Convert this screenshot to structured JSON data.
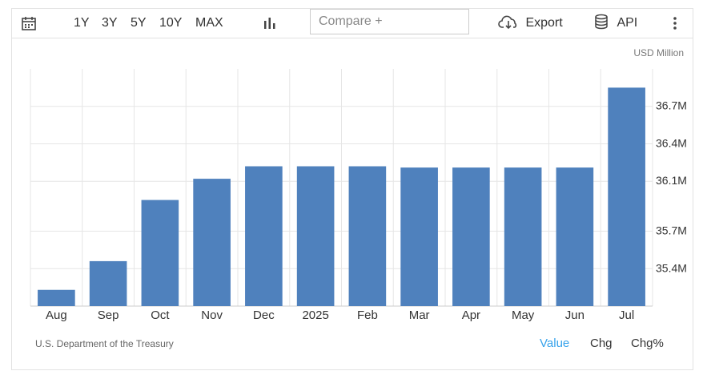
{
  "toolbar": {
    "ranges": [
      "1Y",
      "3Y",
      "5Y",
      "10Y",
      "MAX"
    ],
    "compare_placeholder": "Compare +",
    "export_label": "Export",
    "api_label": "API"
  },
  "unit_label": "USD Million",
  "source_label": "U.S. Department of the Treasury",
  "footer": {
    "value_label": "Value",
    "chg_label": "Chg",
    "chgpct_label": "Chg%"
  },
  "colors": {
    "bar": "#4f81bd",
    "active": "#36a2eb",
    "grid": "#e6e6e6"
  },
  "chart_data": {
    "type": "bar",
    "categories": [
      "Aug",
      "Sep",
      "Oct",
      "Nov",
      "Dec",
      "2025",
      "Feb",
      "Mar",
      "Apr",
      "May",
      "Jun",
      "Jul"
    ],
    "values": [
      35.23,
      35.46,
      35.95,
      36.12,
      36.22,
      36.22,
      36.22,
      36.21,
      36.21,
      36.21,
      36.21,
      36.85
    ],
    "y_tick_labels": [
      "35.4M",
      "35.7M",
      "36.1M",
      "36.4M",
      "36.7M"
    ],
    "y_ticks": [
      35.4,
      35.7,
      36.1,
      36.4,
      36.7
    ],
    "ylim": [
      35.1,
      37.0
    ],
    "grid": true,
    "y_axis_position": "right"
  }
}
